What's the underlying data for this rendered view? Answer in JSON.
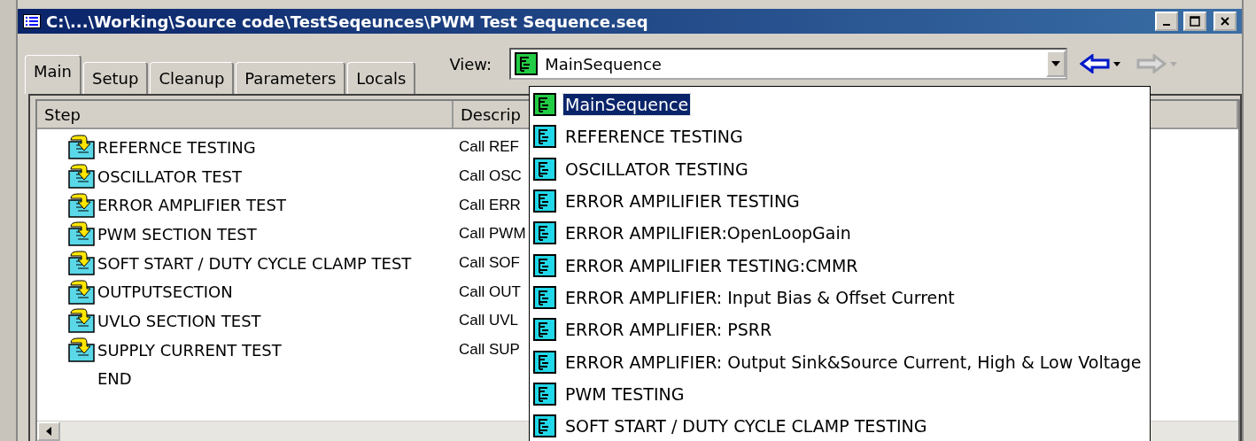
{
  "window": {
    "title": "C:\\...\\Working\\Source code\\TestSeqeunces\\PWM Test Sequence.seq"
  },
  "tabs": [
    {
      "label": "Main",
      "selected": true
    },
    {
      "label": "Setup",
      "selected": false
    },
    {
      "label": "Cleanup",
      "selected": false
    },
    {
      "label": "Parameters",
      "selected": false
    },
    {
      "label": "Locals",
      "selected": false
    }
  ],
  "view": {
    "label": "View:",
    "value": "MainSequence"
  },
  "navigation": {
    "back_enabled": true,
    "forward_enabled": false
  },
  "table": {
    "columns": [
      "Step",
      "Descrip"
    ],
    "rows": [
      {
        "kind": "call",
        "step": "REFERNCE TESTING",
        "description": "Call REF"
      },
      {
        "kind": "call",
        "step": "OSCILLATOR TEST",
        "description": "Call OSC"
      },
      {
        "kind": "call",
        "step": "ERROR AMPLIFIER TEST",
        "description": "Call ERR"
      },
      {
        "kind": "call",
        "step": "PWM SECTION TEST",
        "description": "Call PWM"
      },
      {
        "kind": "call",
        "step": "SOFT START / DUTY CYCLE CLAMP TEST",
        "description": "Call SOF"
      },
      {
        "kind": "call",
        "step": "OUTPUTSECTION",
        "description": "Call OUT"
      },
      {
        "kind": "call",
        "step": "UVLO SECTION TEST",
        "description": "Call UVL"
      },
      {
        "kind": "call",
        "step": "SUPPLY CURRENT TEST",
        "description": "Call SUP"
      },
      {
        "kind": "end",
        "step": "END"
      }
    ]
  },
  "dropdown": {
    "items": [
      {
        "kind": "main",
        "label": "MainSequence",
        "selected": true
      },
      {
        "kind": "sub",
        "label": "REFERENCE TESTING",
        "selected": false
      },
      {
        "kind": "sub",
        "label": "OSCILLATOR TESTING",
        "selected": false
      },
      {
        "kind": "sub",
        "label": "ERROR AMPILIFIER TESTING",
        "selected": false
      },
      {
        "kind": "sub",
        "label": "ERROR AMPILIFIER:OpenLoopGain",
        "selected": false
      },
      {
        "kind": "sub",
        "label": "ERROR AMPILIFIER TESTING:CMMR",
        "selected": false
      },
      {
        "kind": "sub",
        "label": "ERROR AMPLIFIER: Input Bias & Offset Current",
        "selected": false
      },
      {
        "kind": "sub",
        "label": "ERROR AMPLIFIER: PSRR",
        "selected": false
      },
      {
        "kind": "sub",
        "label": "ERROR AMPLIFIER: Output Sink&Source Current, High & Low Voltage",
        "selected": false
      },
      {
        "kind": "sub",
        "label": "PWM TESTING",
        "selected": false
      },
      {
        "kind": "sub",
        "label": "SOFT START / DUTY CYCLE CLAMP TESTING",
        "selected": false
      }
    ]
  }
}
